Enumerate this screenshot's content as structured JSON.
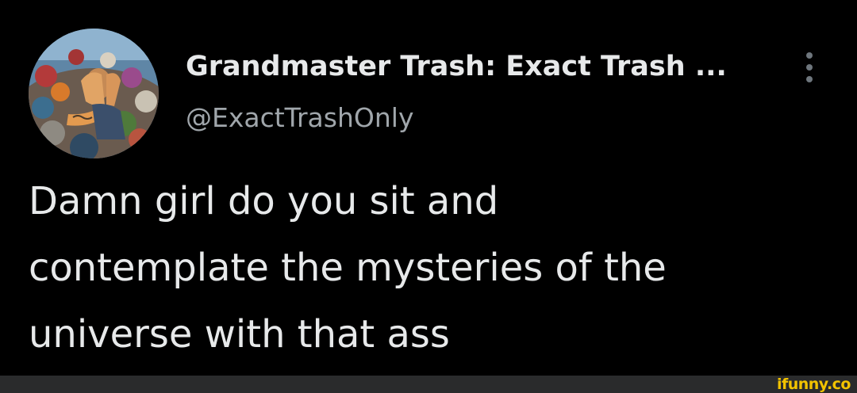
{
  "tweet": {
    "author": {
      "display_name": "Grandmaster Trash: Exact Trash ...",
      "handle": "@ExactTrashOnly",
      "avatar_icon": "avatar-photo"
    },
    "more_icon": "vertical-dots-icon",
    "text_lines": [
      "Damn girl do you sit and",
      "contemplate the mysteries of the",
      "universe with that ass"
    ]
  },
  "watermark": {
    "text": "ifunny.co"
  },
  "colors": {
    "background": "#000000",
    "primary_text": "#e7e9ea",
    "secondary_text": "#a0a6ab",
    "watermark": "#f2c300",
    "watermark_bar": "#2a2b2c"
  }
}
